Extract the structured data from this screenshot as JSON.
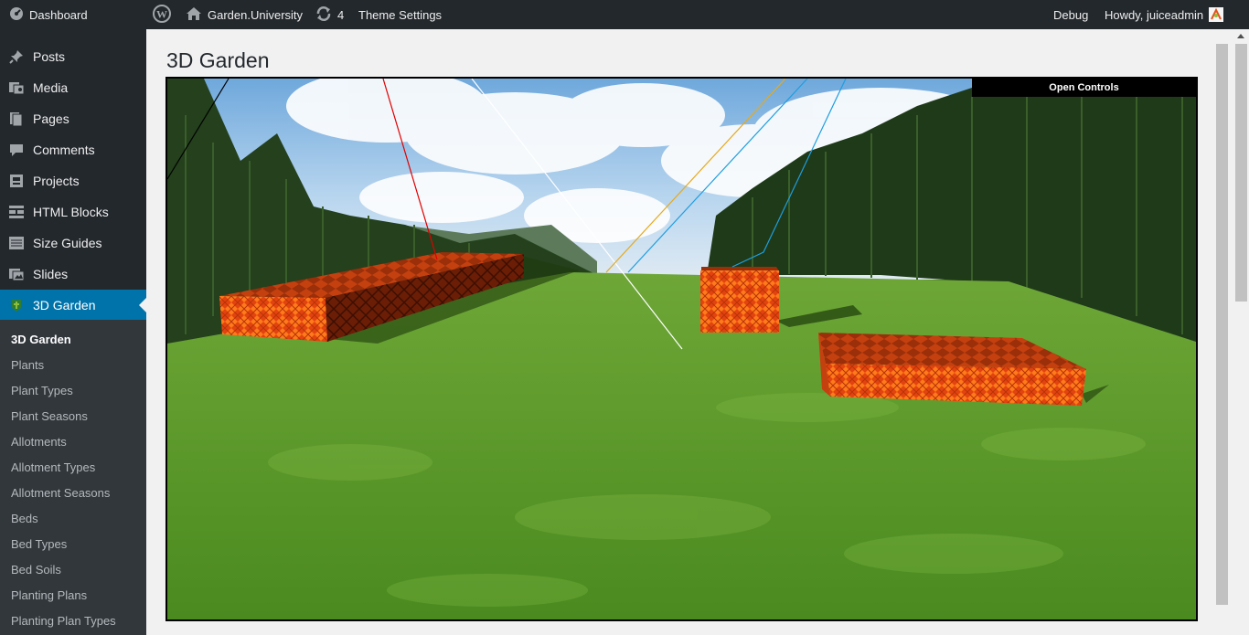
{
  "adminbar": {
    "wp_logo": "wordpress-icon",
    "site_name": "Garden.University",
    "updates_count": "4",
    "theme_settings": "Theme Settings",
    "debug": "Debug",
    "howdy": "Howdy, juiceadmin",
    "dashboard": "Dashboard"
  },
  "sidebar": {
    "items": [
      {
        "label": "Posts",
        "icon": "pin-icon"
      },
      {
        "label": "Media",
        "icon": "media-icon"
      },
      {
        "label": "Pages",
        "icon": "pages-icon"
      },
      {
        "label": "Comments",
        "icon": "comments-icon"
      },
      {
        "label": "Projects",
        "icon": "projects-icon"
      },
      {
        "label": "HTML Blocks",
        "icon": "blocks-icon"
      },
      {
        "label": "Size Guides",
        "icon": "size-guides-icon"
      },
      {
        "label": "Slides",
        "icon": "slides-icon"
      },
      {
        "label": "3D Garden",
        "icon": "garden-icon"
      }
    ],
    "submenu": [
      "3D Garden",
      "Plants",
      "Plant Types",
      "Plant Seasons",
      "Allotments",
      "Allotment Types",
      "Allotment Seasons",
      "Beds",
      "Bed Types",
      "Bed Soils",
      "Planting Plans",
      "Planting Plan Types"
    ]
  },
  "main": {
    "title": "3D Garden",
    "open_controls": "Open Controls"
  },
  "colors": {
    "adminbar_bg": "#23282d",
    "active_menu": "#0073aa",
    "grass": "#4f8f26",
    "planter": "#e4521b"
  }
}
